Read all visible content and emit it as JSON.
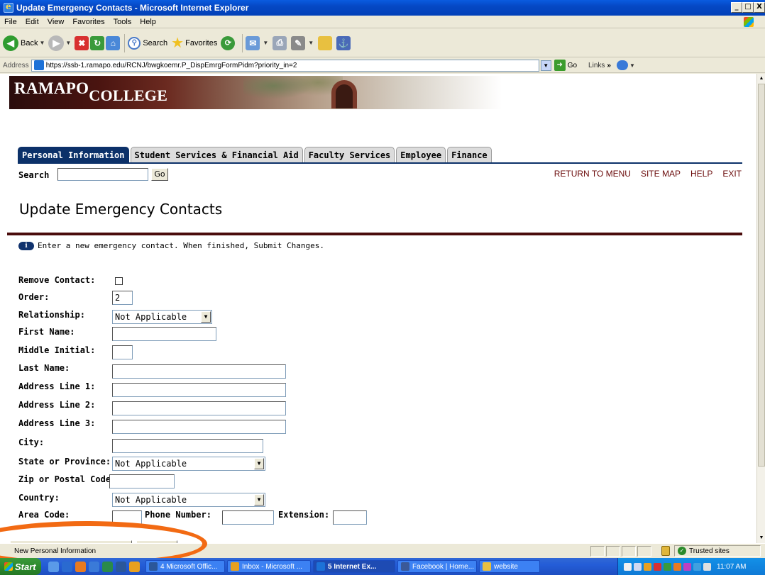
{
  "window": {
    "title": "Update Emergency Contacts - Microsoft Internet Explorer",
    "controls": [
      "_",
      "□",
      "X"
    ]
  },
  "menu": [
    "File",
    "Edit",
    "View",
    "Favorites",
    "Tools",
    "Help"
  ],
  "toolbar": {
    "back_label": "Back",
    "search_label": "Search",
    "favorites_label": "Favorites"
  },
  "address": {
    "label": "Address",
    "url": "https://ssb-1.ramapo.edu/RCNJ/bwgkoemr.P_DispEmrgFormPidm?priority_in=2",
    "go_label": "Go",
    "links_label": "Links"
  },
  "banner": {
    "brand_main": "RAMAPO",
    "brand_sub": "COLLEGE"
  },
  "tabs": [
    {
      "label": "Personal Information",
      "active": true
    },
    {
      "label": "Student Services & Financial Aid",
      "active": false
    },
    {
      "label": "Faculty Services",
      "active": false
    },
    {
      "label": "Employee",
      "active": false
    },
    {
      "label": "Finance",
      "active": false
    }
  ],
  "search": {
    "label": "Search",
    "value": "",
    "go_label": "Go"
  },
  "top_links": [
    "RETURN TO MENU",
    "SITE MAP",
    "HELP",
    "EXIT"
  ],
  "page": {
    "title": "Update Emergency Contacts",
    "info_icon": "i",
    "info_text": "Enter a new emergency contact. When finished, Submit Changes."
  },
  "form": {
    "remove_contact_label": "Remove Contact:",
    "order_label": "Order:",
    "order_value": "2",
    "relationship_label": "Relationship:",
    "relationship_value": "Not Applicable",
    "first_name_label": "First Name:",
    "first_name_value": "",
    "middle_initial_label": "Middle Initial:",
    "middle_initial_value": "",
    "last_name_label": "Last Name:",
    "last_name_value": "",
    "address1_label": "Address Line 1:",
    "address1_value": "",
    "address2_label": "Address Line 2:",
    "address2_value": "",
    "address3_label": "Address Line 3:",
    "address3_value": "",
    "city_label": "City:",
    "city_value": "",
    "state_label": "State or Province:",
    "state_value": "Not Applicable",
    "zip_label": "Zip or Postal Code:",
    "zip_value": "",
    "country_label": "Country:",
    "country_value": "Not Applicable",
    "area_code_label": "Area Code:",
    "area_code_value": "",
    "phone_label": "Phone Number:",
    "phone_value": "",
    "extension_label": "Extension:",
    "extension_value": ""
  },
  "statusbar": {
    "text": "New Personal Information",
    "zone": "Trusted sites"
  },
  "taskbar": {
    "start_label": "Start",
    "tasks": [
      {
        "label": "4 Microsoft Offic...",
        "color": "#2b579a"
      },
      {
        "label": "Inbox - Microsoft ...",
        "color": "#e8a020"
      },
      {
        "label": "5 Internet Ex...",
        "color": "#1d72d8"
      },
      {
        "label": "Facebook | Home...",
        "color": "#3b5998"
      },
      {
        "label": "website",
        "color": "#e8c040"
      }
    ],
    "clock": "11:07 AM"
  },
  "colors": {
    "tab_active": "#0c3169",
    "title_rule": "#4a0c0c",
    "top_links": "#6b0b0b",
    "annotation": "#f26a13"
  }
}
